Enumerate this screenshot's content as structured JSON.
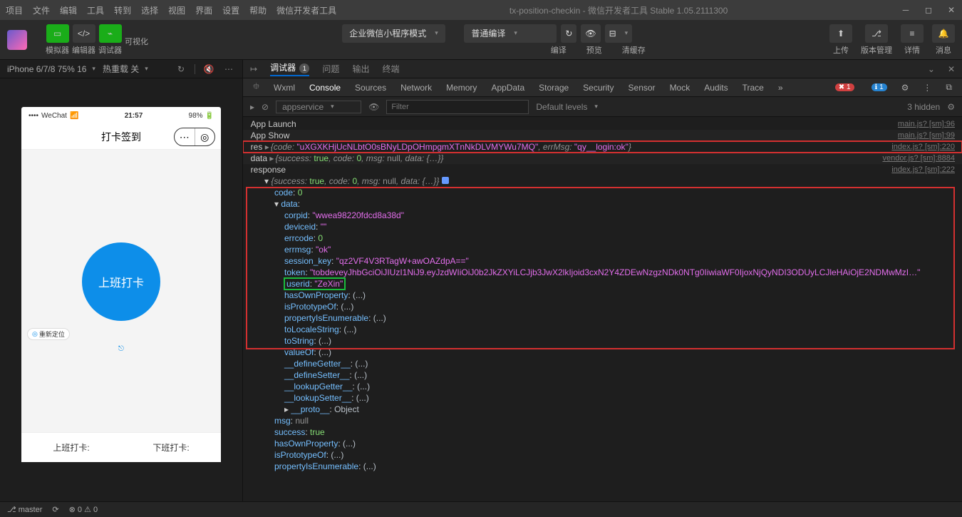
{
  "titlebar": {
    "menus": [
      "项目",
      "文件",
      "编辑",
      "工具",
      "转到",
      "选择",
      "视图",
      "界面",
      "设置",
      "帮助",
      "微信开发者工具"
    ],
    "title": "tx-position-checkin - 微信开发者工具 Stable 1.05.2111300"
  },
  "toolbar": {
    "sim_label": "模拟器",
    "edit_label": "编辑器",
    "tune_label": "调试器",
    "visual_label": "可视化",
    "mode": "企业微信小程序模式",
    "compile": "普通编译",
    "actions": {
      "compile_label": "编译",
      "preview_label": "预览",
      "clear_label": "清缓存"
    },
    "right": {
      "upload": "上传",
      "version": "版本管理",
      "detail": "详情",
      "msg": "消息"
    }
  },
  "simulator": {
    "device": "iPhone 6/7/8 75% 16",
    "hot": "热重载 关",
    "phone": {
      "carrier": "WeChat",
      "time": "21:57",
      "battery": "98%",
      "title": "打卡签到",
      "chip": "重新定位",
      "button": "上班打卡",
      "left_label": "上班打卡:",
      "right_label": "下班打卡:"
    }
  },
  "devtools": {
    "tabs": [
      "调试器",
      "问题",
      "输出",
      "终端"
    ],
    "badge": "1",
    "inspector_tabs": [
      "Wxml",
      "Console",
      "Sources",
      "Network",
      "Memory",
      "AppData",
      "Storage",
      "Security",
      "Sensor",
      "Mock",
      "Audits",
      "Trace"
    ],
    "err_count": "1",
    "info_count": "1",
    "console_context": "appservice",
    "filter_placeholder": "Filter",
    "levels": "Default levels",
    "hidden": "3 hidden",
    "lines": {
      "app_launch": "App Launch",
      "app_show": "App Show",
      "res_label": "res",
      "res_code": "uXGXKHjUcNLbtO0sBNyLDpOHmpgmXTnNkDLVMYWu7MQ",
      "res_errmsg": "qy__login:ok",
      "data_label": "data",
      "response_label": "response",
      "success": "true",
      "code": "0",
      "msg": "null",
      "corpid": "wwea98220fdcd8a38d",
      "deviceid": "",
      "errcode": "0",
      "errmsg": "ok",
      "session_key": "qz2VF4V3RTagW+awOAZdpA==",
      "token": "tobdeveyJhbGciOiJIUzI1NiJ9.eyJzdWIiOiJ0b2JkZXYiLCJjb3JwX2lkIjoid3cxN2Y4ZDEwNzgzNDk0NTg0IiwiaWF0IjoxNjQyNDI3ODUyLCJleHAiOjE2NDMwMzI…",
      "userid": "ZeXin",
      "proto": "Object"
    },
    "sources": {
      "launch": "main.js? [sm]:96",
      "show": "main.js? [sm]:99",
      "res": "index.js? [sm]:220",
      "data": "vendor.js? [sm]:8884",
      "resp": "index.js? [sm]:222"
    }
  },
  "statusbar": {
    "branch": "master",
    "errs": "0",
    "warns": "0"
  }
}
